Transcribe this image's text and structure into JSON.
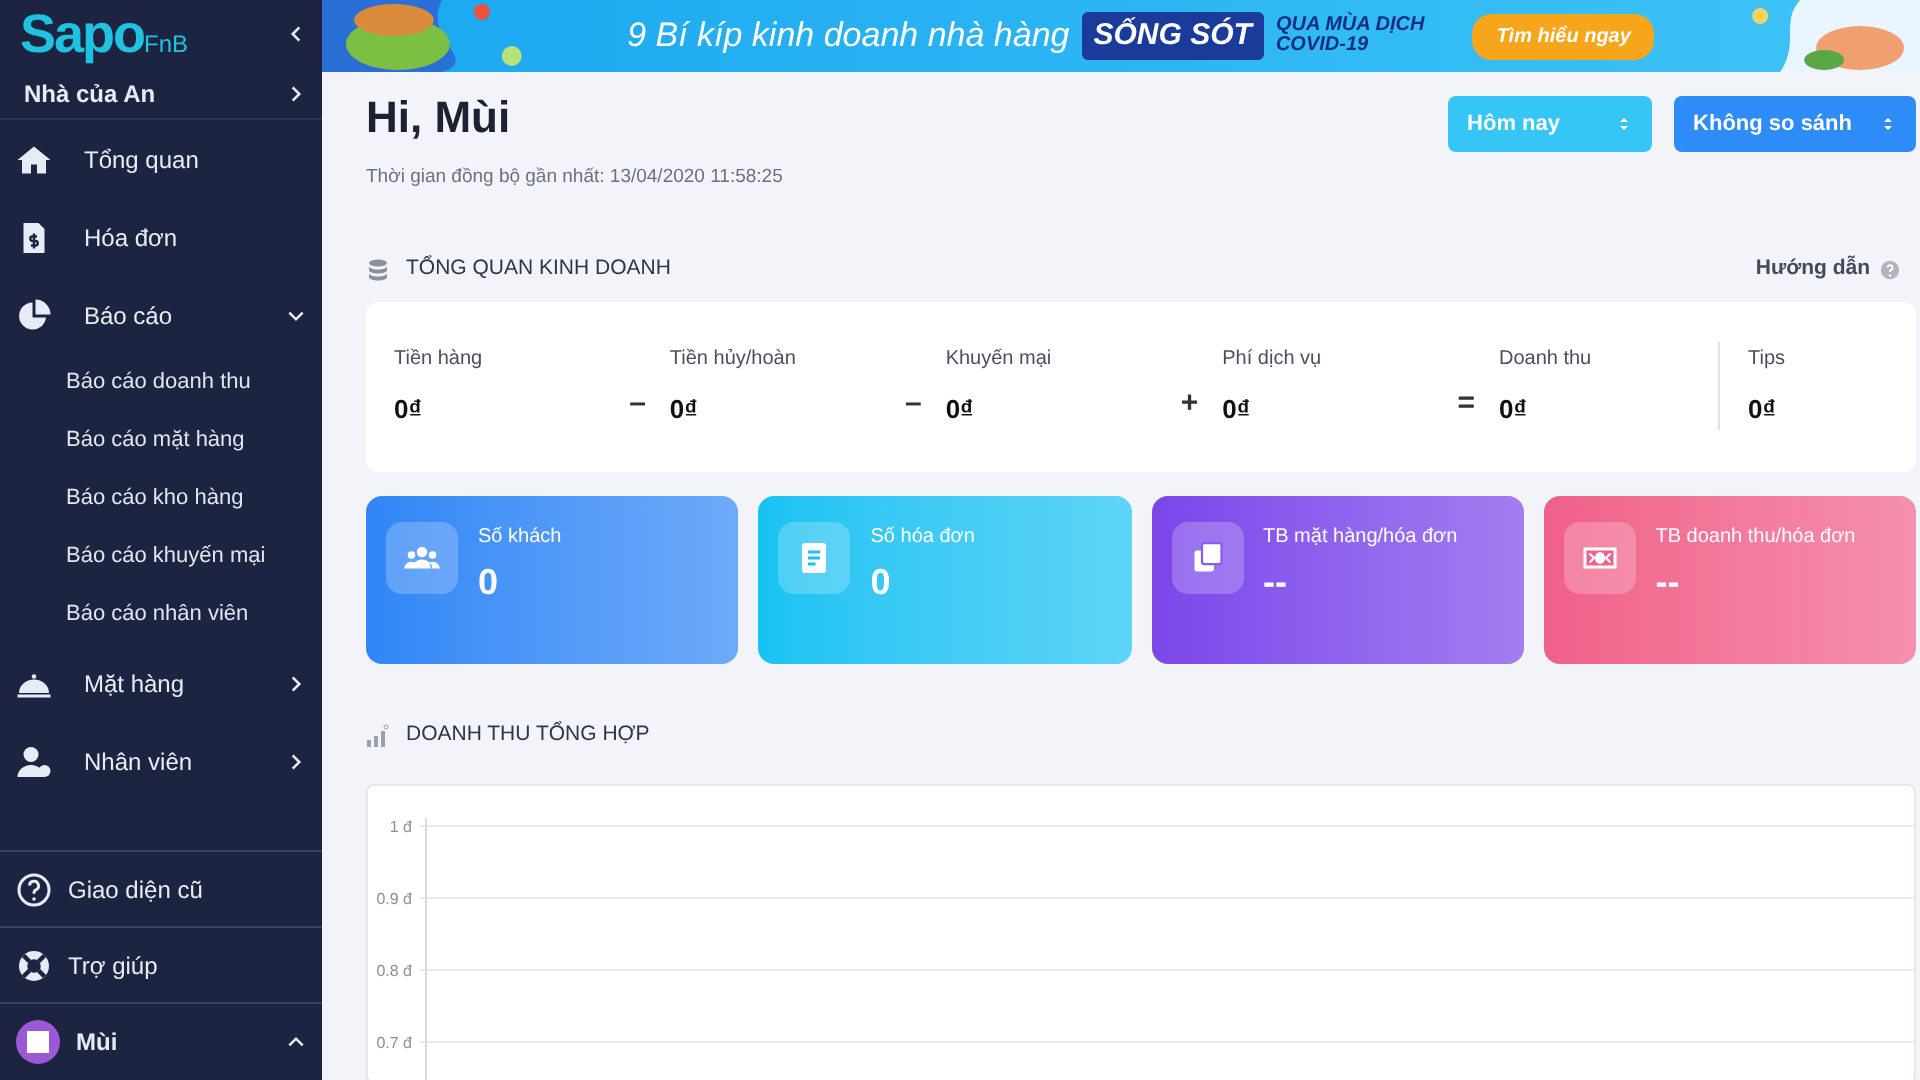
{
  "sidebar": {
    "logo": {
      "brand": "Sapo",
      "suffix": "FnB"
    },
    "store": {
      "name": "Nhà của An"
    },
    "items": [
      {
        "label": "Tổng quan"
      },
      {
        "label": "Hóa đơn"
      },
      {
        "label": "Báo cáo",
        "expanded": true,
        "children": [
          {
            "label": "Báo cáo doanh thu"
          },
          {
            "label": "Báo cáo mặt hàng"
          },
          {
            "label": "Báo cáo kho hàng"
          },
          {
            "label": "Báo cáo khuyến mại"
          },
          {
            "label": "Báo cáo nhân viên"
          }
        ]
      },
      {
        "label": "Mặt hàng",
        "expanded": false
      },
      {
        "label": "Nhân viên",
        "expanded": false
      }
    ],
    "footer_items": [
      {
        "label": "Giao diện cũ"
      },
      {
        "label": "Trợ giúp"
      }
    ],
    "user": {
      "name": "Mùi",
      "expanded": true
    }
  },
  "banner": {
    "headline": "9 Bí kíp kinh doanh nhà hàng",
    "highlight": "SỐNG SÓT",
    "tagline_1": "QUA MÙA DỊCH",
    "tagline_2": "COVID-19",
    "button": "Tìm hiểu ngay"
  },
  "header": {
    "greeting": "Hi, Mùi",
    "sync_text": "Thời gian đồng bộ gần nhất: 13/04/2020 11:58:25",
    "period_select": "Hôm nay",
    "compare_select": "Không so sánh"
  },
  "overview": {
    "title": "TỔNG QUAN KINH DOANH",
    "help_link": "Hướng dẫn",
    "metrics": [
      {
        "label": "Tiền hàng",
        "value": "0₫",
        "operator": "–"
      },
      {
        "label": "Tiền hủy/hoàn",
        "value": "0₫",
        "operator": "–"
      },
      {
        "label": "Khuyến mại",
        "value": "0₫",
        "operator": "+"
      },
      {
        "label": "Phí dịch vụ",
        "value": "0₫",
        "operator": "="
      },
      {
        "label": "Doanh thu",
        "value": "0₫"
      },
      {
        "label": "Tips",
        "value": "0₫"
      }
    ]
  },
  "stat_cards": [
    {
      "label": "Số khách",
      "value": "0",
      "color": "#2f86f6"
    },
    {
      "label": "Số hóa đơn",
      "value": "0",
      "color": "#17c2f3"
    },
    {
      "label": "TB mặt hàng/hóa đơn",
      "value": "--",
      "color": "#7b45ea"
    },
    {
      "label": "TB doanh thu/hóa đơn",
      "value": "--",
      "color": "#f0608a"
    }
  ],
  "revenue": {
    "title": "DOANH THU TỔNG HỢP",
    "axis_labels": [
      "1 đ",
      "0.9 đ",
      "0.8 đ",
      "0.7 đ"
    ]
  }
}
